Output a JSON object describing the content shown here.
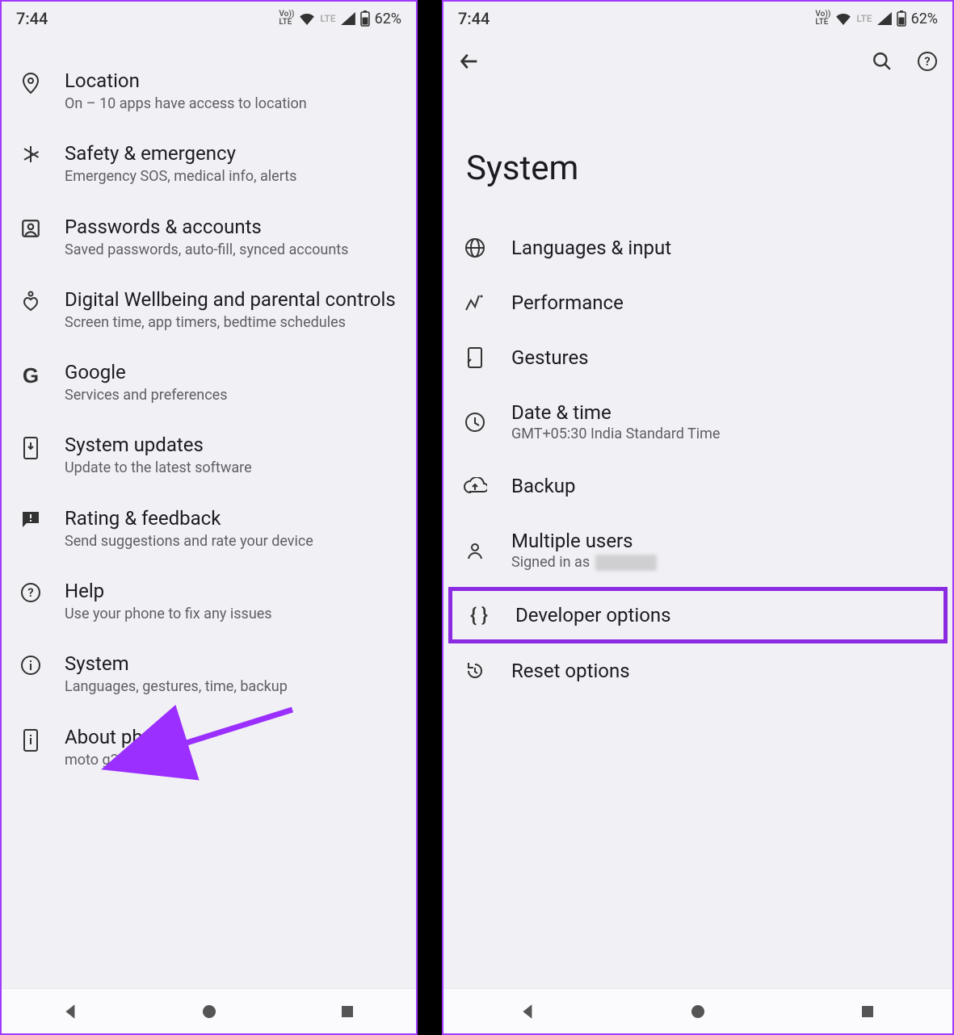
{
  "statusbar": {
    "time": "7:44",
    "volte": "Vo LTE",
    "lte": "LTE",
    "battery_pct": "62%"
  },
  "left": {
    "items": [
      {
        "id": "location",
        "title": "Location",
        "subtitle": "On – 10 apps have access to location"
      },
      {
        "id": "safety",
        "title": "Safety & emergency",
        "subtitle": "Emergency SOS, medical info, alerts"
      },
      {
        "id": "passwords",
        "title": "Passwords & accounts",
        "subtitle": "Saved passwords, auto-fill, synced accounts"
      },
      {
        "id": "wellbeing",
        "title": "Digital Wellbeing and parental controls",
        "subtitle": "Screen time, app timers, bedtime schedules"
      },
      {
        "id": "google",
        "title": "Google",
        "subtitle": "Services and preferences"
      },
      {
        "id": "system-updates",
        "title": "System updates",
        "subtitle": "Update to the latest software"
      },
      {
        "id": "rating",
        "title": "Rating & feedback",
        "subtitle": "Send suggestions and rate your device"
      },
      {
        "id": "help",
        "title": "Help",
        "subtitle": "Use your phone to fix any issues"
      },
      {
        "id": "system",
        "title": "System",
        "subtitle": "Languages, gestures, time, backup"
      },
      {
        "id": "about",
        "title": "About phone",
        "subtitle": "moto g32"
      }
    ]
  },
  "right": {
    "page_title": "System",
    "items": [
      {
        "id": "languages",
        "title": "Languages & input",
        "subtitle": ""
      },
      {
        "id": "performance",
        "title": "Performance",
        "subtitle": ""
      },
      {
        "id": "gestures",
        "title": "Gestures",
        "subtitle": ""
      },
      {
        "id": "datetime",
        "title": "Date & time",
        "subtitle": "GMT+05:30 India Standard Time"
      },
      {
        "id": "backup",
        "title": "Backup",
        "subtitle": ""
      },
      {
        "id": "multiuser",
        "title": "Multiple users",
        "subtitle_prefix": "Signed in as "
      },
      {
        "id": "devopts",
        "title": "Developer options",
        "subtitle": ""
      },
      {
        "id": "reset",
        "title": "Reset options",
        "subtitle": ""
      }
    ]
  },
  "annotations": {
    "highlight_item": "devopts",
    "arrow_target": "system"
  }
}
